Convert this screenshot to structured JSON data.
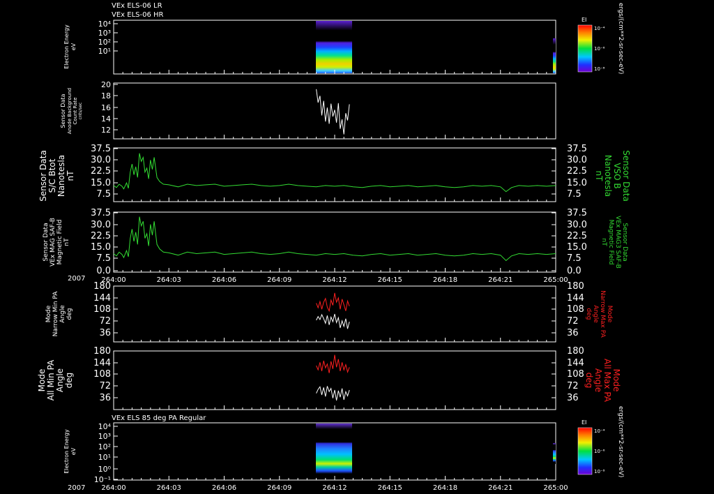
{
  "header": {
    "line1": "VEx ELS-06 LR",
    "line2": "VEx ELS-06 HR"
  },
  "colorbar_unit": "ergs/(cm**2-sr-sec-eV)",
  "time": {
    "year": "2007",
    "ticks": [
      "264:00",
      "264:03",
      "264:06",
      "264:09",
      "264:12",
      "264:15",
      "264:18",
      "264:21",
      "265:00"
    ]
  },
  "chart_data": [
    {
      "id": "panel1",
      "type": "heatmap",
      "ylabel": [
        "Electron Energy",
        "eV"
      ],
      "yticks": [
        "10⁴",
        "10³",
        "10²",
        "10¹"
      ],
      "log": true,
      "colorbar": {
        "title": "EI",
        "ticks": [
          "10⁻⁴",
          "10⁻⁶",
          "10⁻⁸"
        ]
      },
      "data_window": {
        "start": "264:11",
        "end": "264:12:48"
      }
    },
    {
      "id": "panel2",
      "type": "line",
      "ylabel": [
        "Sensor Data",
        "Anode Background",
        "Count Rate",
        "cnts/sec"
      ],
      "yticks": [
        "20",
        "18",
        "16",
        "14",
        "12"
      ],
      "ylim": [
        10,
        20
      ],
      "series": [
        {
          "color": "#ffffff",
          "x": [
            11.0,
            11.1,
            11.2,
            11.3,
            11.4,
            11.5,
            11.6,
            11.7,
            11.8,
            11.9,
            12.0,
            12.1,
            12.2,
            12.3,
            12.4,
            12.5,
            12.6,
            12.7,
            12.8
          ],
          "y": [
            18.9,
            16.5,
            17.7,
            14.2,
            16.8,
            13.1,
            15.6,
            12.7,
            16.3,
            14.0,
            15.2,
            12.9,
            16.4,
            11.8,
            13.5,
            10.8,
            14.6,
            13.3,
            16.2
          ]
        }
      ]
    },
    {
      "id": "panel3",
      "type": "line",
      "ylabel": [
        "Sensor Data",
        "S/C Btot",
        "Nanotesla",
        "nT"
      ],
      "ylabel_right": [
        "Sensor Data",
        "VSO B",
        "Nanotesla",
        "nT"
      ],
      "yticks": [
        "37.5",
        "30.0",
        "22.5",
        "15.0",
        "7.5"
      ],
      "ylim": [
        0,
        40
      ],
      "series": [
        {
          "color": "#33dd33",
          "x": [
            0.0,
            0.15,
            0.3,
            0.45,
            0.55,
            0.7,
            0.8,
            0.9,
            1.0,
            1.1,
            1.2,
            1.3,
            1.4,
            1.5,
            1.6,
            1.7,
            1.8,
            1.9,
            2.0,
            2.1,
            2.2,
            2.35,
            2.5,
            2.7,
            3.0,
            3.5,
            4.0,
            4.5,
            5.0,
            5.5,
            6.0,
            6.5,
            7.0,
            7.5,
            8.0,
            8.5,
            9.0,
            9.5,
            10.0,
            10.5,
            11.0,
            11.5,
            12.0,
            12.5,
            13.0,
            13.5,
            14.0,
            14.5,
            15.0,
            15.5,
            16.0,
            16.5,
            17.0,
            17.5,
            18.0,
            18.5,
            19.0,
            19.5,
            20.0,
            20.5,
            21.0,
            21.3,
            21.6,
            22.0,
            22.5,
            23.0,
            23.5,
            24.0
          ],
          "y": [
            12,
            10.5,
            13,
            11.5,
            9.5,
            14,
            10,
            22,
            28,
            20,
            26,
            18,
            36,
            30,
            33,
            22,
            25,
            17,
            31,
            24,
            33,
            18,
            15,
            13,
            12.5,
            11,
            13,
            12,
            12.5,
            13,
            11.5,
            12,
            12.5,
            13,
            12,
            11.5,
            12,
            13,
            12,
            11.5,
            11,
            12,
            11.5,
            12,
            11,
            10.5,
            11.5,
            12,
            11,
            11.5,
            12,
            11,
            11.5,
            12,
            11,
            10.5,
            11,
            12,
            11.5,
            12,
            11,
            7.5,
            10.5,
            12,
            11.5,
            12,
            11.5,
            12
          ]
        }
      ]
    },
    {
      "id": "panel4",
      "type": "line",
      "ylabel": [
        "Sensor Data",
        "VEx MAG SAF-B",
        "Magnetic Field",
        "nT"
      ],
      "ylabel_right": [
        "Sensor Data",
        "VEx MAG3 SAF-B",
        "Magnetic Field",
        "nT"
      ],
      "yticks": [
        "37.5",
        "30.0",
        "22.5",
        "15.0",
        "7.5",
        "0.0"
      ],
      "ylim": [
        0,
        39
      ],
      "series": [
        {
          "color": "#33dd33",
          "x": [
            0.0,
            0.15,
            0.3,
            0.45,
            0.55,
            0.7,
            0.8,
            0.9,
            1.0,
            1.1,
            1.2,
            1.3,
            1.4,
            1.5,
            1.6,
            1.7,
            1.8,
            1.9,
            2.0,
            2.1,
            2.2,
            2.35,
            2.5,
            2.7,
            3.0,
            3.5,
            4.0,
            4.5,
            5.0,
            5.5,
            6.0,
            6.5,
            7.0,
            7.5,
            8.0,
            8.5,
            9.0,
            9.5,
            10.0,
            10.5,
            11.0,
            11.5,
            12.0,
            12.5,
            13.0,
            13.5,
            14.0,
            14.5,
            15.0,
            15.5,
            16.0,
            16.5,
            17.0,
            17.5,
            18.0,
            18.5,
            19.0,
            19.5,
            20.0,
            20.5,
            21.0,
            21.3,
            21.6,
            22.0,
            22.5,
            23.0,
            23.5,
            24.0
          ],
          "y": [
            12,
            10.5,
            13,
            11.5,
            9.5,
            14,
            10,
            22,
            28,
            20,
            26,
            18,
            36,
            30,
            33,
            22,
            25,
            17,
            31,
            24,
            33,
            18,
            15,
            13,
            12.5,
            11,
            13,
            12,
            12.5,
            13,
            11.5,
            12,
            12.5,
            13,
            12,
            11.5,
            12,
            13,
            12,
            11.5,
            11,
            12,
            11.5,
            12,
            11,
            10.5,
            11.5,
            12,
            11,
            11.5,
            12,
            11,
            11.5,
            12,
            11,
            10.5,
            11,
            12,
            11.5,
            12,
            11,
            7.5,
            10.5,
            12,
            11.5,
            12,
            11.5,
            12
          ]
        }
      ]
    },
    {
      "id": "panel5",
      "type": "line",
      "ylabel": [
        "Mode",
        "Narrow Min PA",
        "Angle",
        "deg"
      ],
      "ylabel_right": [
        "Mode",
        "Narrow Max PA",
        "Angle",
        "deg"
      ],
      "yticks": [
        "180",
        "144",
        "108",
        "72",
        "36"
      ],
      "ylim": [
        0,
        180
      ],
      "series": [
        {
          "color": "#ff2020",
          "x": [
            11.0,
            11.1,
            11.2,
            11.3,
            11.4,
            11.5,
            11.6,
            11.7,
            11.8,
            11.9,
            12.0,
            12.1,
            12.2,
            12.3,
            12.4,
            12.5,
            12.6,
            12.7,
            12.8
          ],
          "y": [
            125,
            110,
            130,
            105,
            128,
            140,
            112,
            100,
            135,
            118,
            158,
            128,
            142,
            105,
            138,
            120,
            100,
            132,
            115
          ]
        },
        {
          "color": "#ffffff",
          "x": [
            11.0,
            11.1,
            11.2,
            11.3,
            11.4,
            11.5,
            11.6,
            11.7,
            11.8,
            11.9,
            12.0,
            12.1,
            12.2,
            12.3,
            12.4,
            12.5,
            12.6,
            12.7,
            12.8
          ],
          "y": [
            70,
            82,
            72,
            88,
            75,
            60,
            85,
            55,
            80,
            65,
            90,
            62,
            78,
            45,
            68,
            50,
            75,
            42,
            65
          ]
        }
      ]
    },
    {
      "id": "panel6",
      "type": "line",
      "ylabel": [
        "Mode",
        "All Min PA",
        "Angle",
        "deg"
      ],
      "ylabel_right": [
        "Mode",
        "All Max PA",
        "Angle",
        "deg"
      ],
      "yticks": [
        "180",
        "144",
        "108",
        "72",
        "36"
      ],
      "ylim": [
        0,
        180
      ],
      "series": [
        {
          "color": "#ff2020",
          "x": [
            11.0,
            11.1,
            11.2,
            11.3,
            11.4,
            11.5,
            11.6,
            11.7,
            11.8,
            11.9,
            12.0,
            12.1,
            12.2,
            12.3,
            12.4,
            12.5,
            12.6,
            12.7,
            12.8
          ],
          "y": [
            135,
            122,
            145,
            118,
            150,
            128,
            140,
            112,
            148,
            125,
            168,
            130,
            155,
            118,
            145,
            122,
            138,
            115,
            130
          ]
        },
        {
          "color": "#ffffff",
          "x": [
            11.0,
            11.1,
            11.2,
            11.3,
            11.4,
            11.5,
            11.6,
            11.7,
            11.8,
            11.9,
            12.0,
            12.1,
            12.2,
            12.3,
            12.4,
            12.5,
            12.6,
            12.7,
            12.8
          ],
          "y": [
            50,
            62,
            70,
            45,
            68,
            40,
            72,
            55,
            65,
            35,
            60,
            28,
            58,
            38,
            65,
            30,
            55,
            42,
            60
          ]
        }
      ]
    },
    {
      "id": "panel7",
      "type": "heatmap",
      "title": "VEx ELS 85 deg PA Regular",
      "ylabel": [
        "Electron Energy",
        "eV"
      ],
      "yticks": [
        "10⁴",
        "10³",
        "10²",
        "10¹",
        "10⁰",
        "10⁻¹"
      ],
      "log": true,
      "colorbar": {
        "title": "EI",
        "ticks": [
          "10⁻⁴",
          "10⁻⁶",
          "10⁻⁸"
        ]
      },
      "data_window": {
        "start": "264:11",
        "end": "264:12:48"
      }
    }
  ]
}
